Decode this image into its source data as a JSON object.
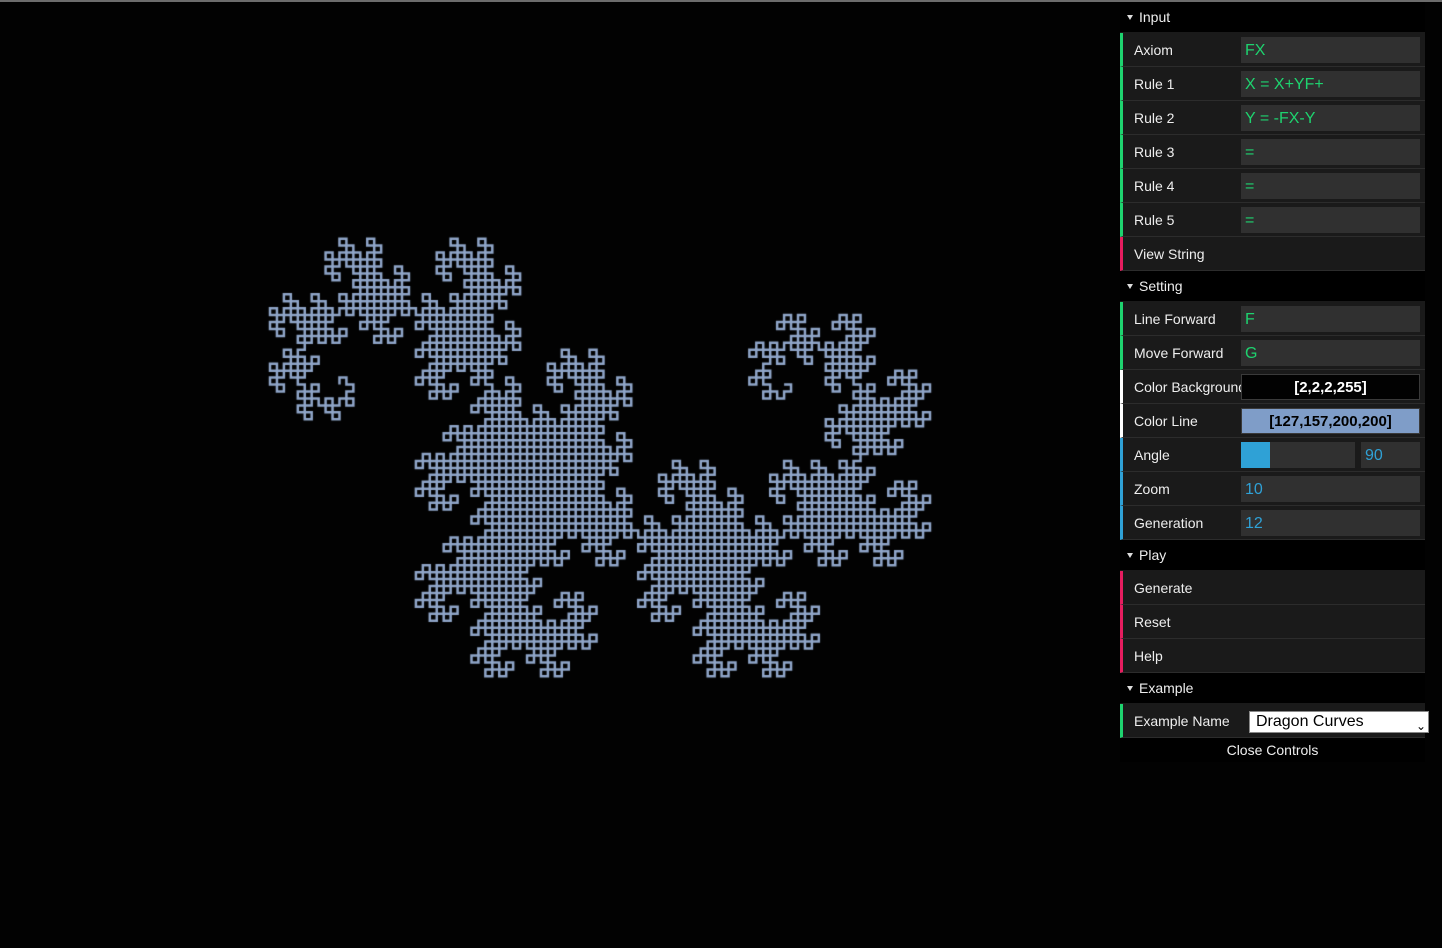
{
  "drawing": {
    "axiom": "FX",
    "rules": [
      "X=X+YF+",
      "Y=-FX-Y"
    ],
    "angle": 90,
    "generation": 12,
    "line_color": "#8fa5c8",
    "background_color": "#020202"
  },
  "controls": {
    "input": {
      "title": "Input",
      "axiom_label": "Axiom",
      "axiom_value": "FX",
      "rule1_label": "Rule 1",
      "rule1_value": "X = X+YF+",
      "rule2_label": "Rule 2",
      "rule2_value": "Y = -FX-Y",
      "rule3_label": "Rule 3",
      "rule3_value": "=",
      "rule4_label": "Rule 4",
      "rule4_value": "=",
      "rule5_label": "Rule 5",
      "rule5_value": "=",
      "view_string_label": "View String"
    },
    "setting": {
      "title": "Setting",
      "line_forward_label": "Line Forward",
      "line_forward_value": "F",
      "move_forward_label": "Move Forward",
      "move_forward_value": "G",
      "color_background_label": "Color Background",
      "color_background_value": "[2,2,2,255]",
      "color_background_swatch": "#020202",
      "color_line_label": "Color Line",
      "color_line_value": "[127,157,200,200]",
      "color_line_swatch": "#7f9dc8",
      "angle_label": "Angle",
      "angle_value": "90",
      "angle_fraction": 0.25,
      "zoom_label": "Zoom",
      "zoom_value": "10",
      "generation_label": "Generation",
      "generation_value": "12"
    },
    "play": {
      "title": "Play",
      "generate_label": "Generate",
      "reset_label": "Reset",
      "help_label": "Help"
    },
    "example": {
      "title": "Example",
      "example_name_label": "Example Name",
      "example_name_value": "Dragon Curves"
    },
    "close_label": "Close Controls",
    "accent_string": "#1ed36f",
    "accent_function": "#e61d5f",
    "accent_number": "#2fa1d6"
  }
}
